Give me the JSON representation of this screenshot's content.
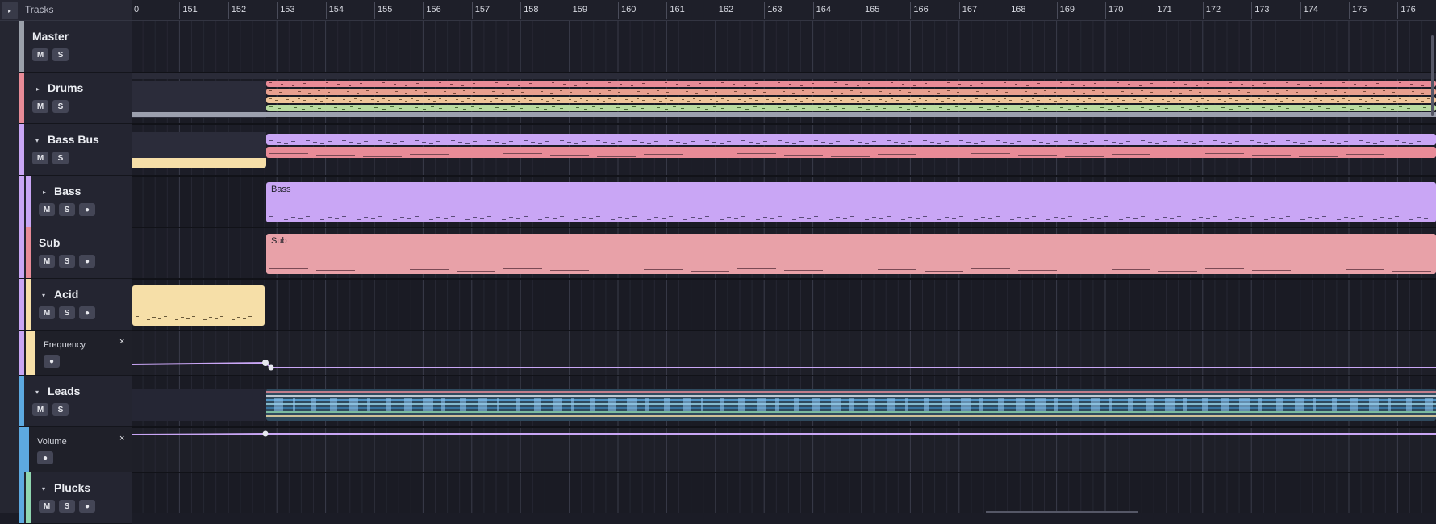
{
  "header": {
    "title": "Tracks",
    "collapse_icon": "▸"
  },
  "ruler": {
    "bars": [
      "0",
      "151",
      "152",
      "153",
      "154",
      "155",
      "156",
      "157",
      "158",
      "159",
      "160",
      "161",
      "162",
      "163",
      "164",
      "165",
      "166",
      "167",
      "168",
      "169",
      "170",
      "171",
      "172",
      "173",
      "174",
      "175",
      "176"
    ]
  },
  "tracks": {
    "master": {
      "name": "Master",
      "mute": "M",
      "solo": "S",
      "color": "#9aa0aa"
    },
    "drums": {
      "name": "Drums",
      "mute": "M",
      "solo": "S",
      "arrow": "▸",
      "color": "#e88b97"
    },
    "bassbus": {
      "name": "Bass Bus",
      "mute": "M",
      "solo": "S",
      "arrow": "▾",
      "color": "#c9a6f5"
    },
    "bass": {
      "name": "Bass",
      "mute": "M",
      "solo": "S",
      "rec": "●",
      "arrow": "▸",
      "color": "#c9a6f5"
    },
    "sub": {
      "name": "Sub",
      "mute": "M",
      "solo": "S",
      "rec": "●",
      "color": "#e88b97"
    },
    "acid": {
      "name": "Acid",
      "mute": "M",
      "solo": "S",
      "rec": "●",
      "arrow": "▾",
      "color": "#f6dfa8"
    },
    "frequency": {
      "name": "Frequency",
      "rec": "●",
      "close": "×"
    },
    "leads": {
      "name": "Leads",
      "mute": "M",
      "solo": "S",
      "arrow": "▾",
      "color": "#5da9e0"
    },
    "volume": {
      "name": "Volume",
      "rec": "●",
      "close": "×"
    },
    "plucks": {
      "name": "Plucks",
      "mute": "M",
      "solo": "S",
      "rec": "●",
      "arrow": "▾",
      "color": "#8fd6b0"
    }
  },
  "clips": {
    "bass": "Bass",
    "sub": "Sub"
  }
}
